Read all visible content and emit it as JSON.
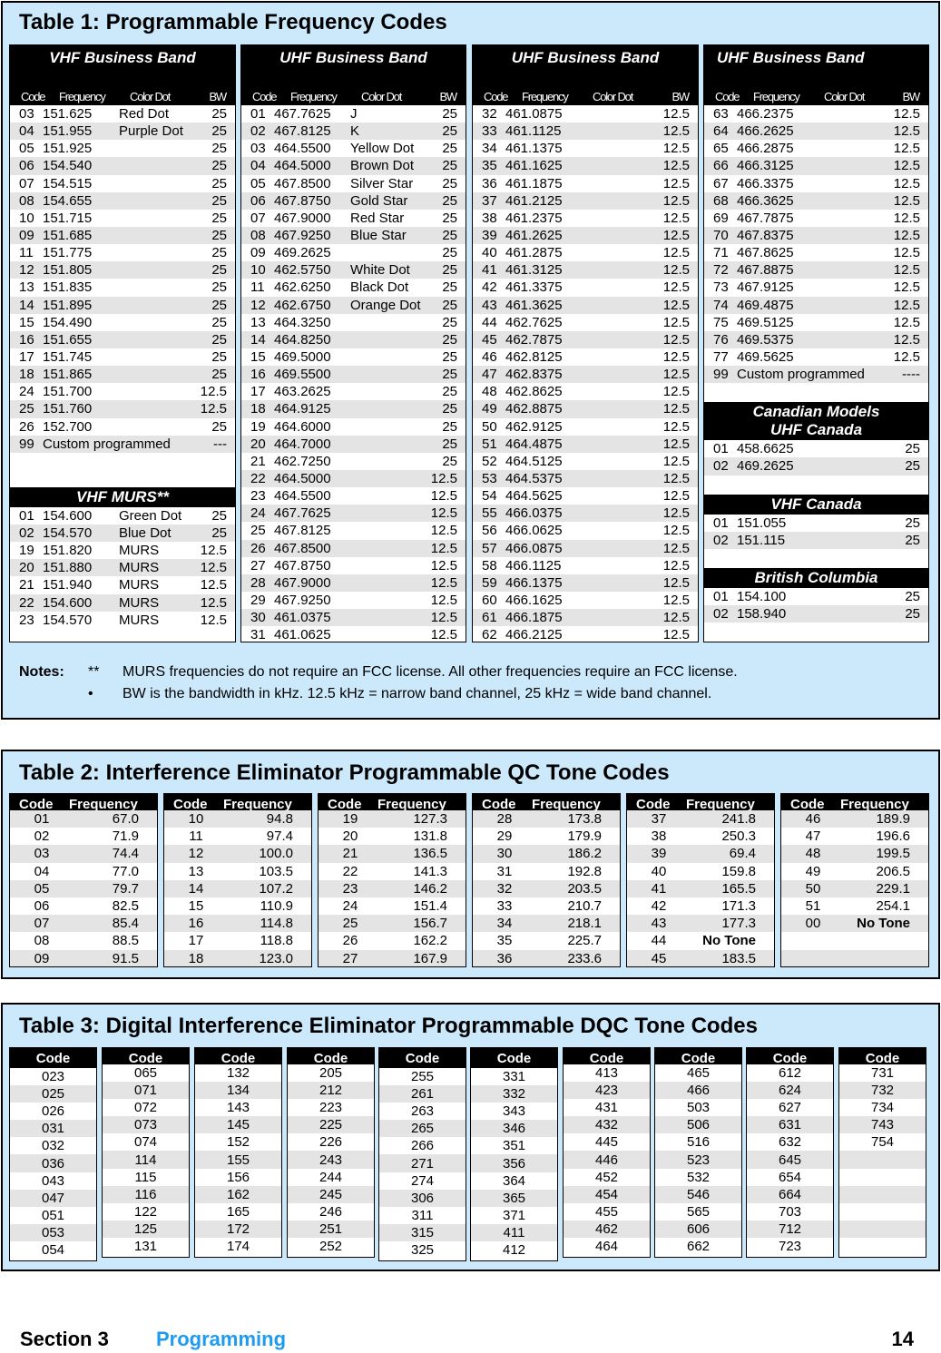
{
  "table1": {
    "title": "Table 1:  Programmable Frequency Codes",
    "col_headers": [
      "Code",
      "Frequency",
      "Color Dot",
      "BW"
    ],
    "vhf_business": {
      "title": "VHF Business Band",
      "rows": [
        [
          "03",
          "151.625",
          "Red Dot",
          "25"
        ],
        [
          "04",
          "151.955",
          "Purple Dot",
          "25"
        ],
        [
          "05",
          "151.925",
          "",
          "25"
        ],
        [
          "06",
          "154.540",
          "",
          "25"
        ],
        [
          "07",
          "154.515",
          "",
          "25"
        ],
        [
          "08",
          "154.655",
          "",
          "25"
        ],
        [
          "10",
          "151.715",
          "",
          "25"
        ],
        [
          "09",
          "151.685",
          "",
          "25"
        ],
        [
          "11",
          "151.775",
          "",
          "25"
        ],
        [
          "12",
          "151.805",
          "",
          "25"
        ],
        [
          "13",
          "151.835",
          "",
          "25"
        ],
        [
          "14",
          "151.895",
          "",
          "25"
        ],
        [
          "15",
          "154.490",
          "",
          "25"
        ],
        [
          "16",
          "151.655",
          "",
          "25"
        ],
        [
          "17",
          "151.745",
          "",
          "25"
        ],
        [
          "18",
          "151.865",
          "",
          "25"
        ],
        [
          "24",
          "151.700",
          "",
          "12.5"
        ],
        [
          "25",
          "151.760",
          "",
          "12.5"
        ],
        [
          "26",
          "152.700",
          "",
          "25"
        ],
        [
          "99",
          "Custom programmed",
          "",
          "---"
        ]
      ]
    },
    "vhf_murs": {
      "title": "VHF MURS**",
      "rows": [
        [
          "01",
          "154.600",
          "Green Dot",
          "25"
        ],
        [
          "02",
          "154.570",
          "Blue Dot",
          "25"
        ],
        [
          "19",
          "151.820",
          "MURS",
          "12.5"
        ],
        [
          "20",
          "151.880",
          "MURS",
          "12.5"
        ],
        [
          "21",
          "151.940",
          "MURS",
          "12.5"
        ],
        [
          "22",
          "154.600",
          "MURS",
          "12.5"
        ],
        [
          "23",
          "154.570",
          "MURS",
          "12.5"
        ]
      ]
    },
    "uhf_business_1": {
      "title": "UHF Business Band",
      "rows": [
        [
          "01",
          "467.7625",
          "J",
          "25"
        ],
        [
          "02",
          "467.8125",
          "K",
          "25"
        ],
        [
          "03",
          "464.5500",
          "Yellow Dot",
          "25"
        ],
        [
          "04",
          "464.5000",
          "Brown Dot",
          "25"
        ],
        [
          "05",
          "467.8500",
          "Silver Star",
          "25"
        ],
        [
          "06",
          "467.8750",
          "Gold Star",
          "25"
        ],
        [
          "07",
          "467.9000",
          "Red Star",
          "25"
        ],
        [
          "08",
          "467.9250",
          "Blue Star",
          "25"
        ],
        [
          "09",
          "469.2625",
          "",
          "25"
        ],
        [
          "10",
          "462.5750",
          "White Dot",
          "25"
        ],
        [
          "11",
          "462.6250",
          "Black Dot",
          "25"
        ],
        [
          "12",
          "462.6750",
          "Orange Dot",
          "25"
        ],
        [
          "13",
          "464.3250",
          "",
          "25"
        ],
        [
          "14",
          "464.8250",
          "",
          "25"
        ],
        [
          "15",
          "469.5000",
          "",
          "25"
        ],
        [
          "16",
          "469.5500",
          "",
          "25"
        ],
        [
          "17",
          "463.2625",
          "",
          "25"
        ],
        [
          "18",
          "464.9125",
          "",
          "25"
        ],
        [
          "19",
          "464.6000",
          "",
          "25"
        ],
        [
          "20",
          "464.7000",
          "",
          "25"
        ],
        [
          "21",
          "462.7250",
          "",
          "25"
        ],
        [
          "22",
          "464.5000",
          "",
          "12.5"
        ],
        [
          "23",
          "464.5500",
          "",
          "12.5"
        ],
        [
          "24",
          "467.7625",
          "",
          "12.5"
        ],
        [
          "25",
          "467.8125",
          "",
          "12.5"
        ],
        [
          "26",
          "467.8500",
          "",
          "12.5"
        ],
        [
          "27",
          "467.8750",
          "",
          "12.5"
        ],
        [
          "28",
          "467.9000",
          "",
          "12.5"
        ],
        [
          "29",
          "467.9250",
          "",
          "12.5"
        ],
        [
          "30",
          "461.0375",
          "",
          "12.5"
        ],
        [
          "31",
          "461.0625",
          "",
          "12.5"
        ]
      ]
    },
    "uhf_business_2": {
      "title": "UHF Business Band",
      "rows": [
        [
          "32",
          "461.0875",
          "",
          "12.5"
        ],
        [
          "33",
          "461.1125",
          "",
          "12.5"
        ],
        [
          "34",
          "461.1375",
          "",
          "12.5"
        ],
        [
          "35",
          "461.1625",
          "",
          "12.5"
        ],
        [
          "36",
          "461.1875",
          "",
          "12.5"
        ],
        [
          "37",
          "461.2125",
          "",
          "12.5"
        ],
        [
          "38",
          "461.2375",
          "",
          "12.5"
        ],
        [
          "39",
          "461.2625",
          "",
          "12.5"
        ],
        [
          "40",
          "461.2875",
          "",
          "12.5"
        ],
        [
          "41",
          "461.3125",
          "",
          "12.5"
        ],
        [
          "42",
          "461.3375",
          "",
          "12.5"
        ],
        [
          "43",
          "461.3625",
          "",
          "12.5"
        ],
        [
          "44",
          "462.7625",
          "",
          "12.5"
        ],
        [
          "45",
          "462.7875",
          "",
          "12.5"
        ],
        [
          "46",
          "462.8125",
          "",
          "12.5"
        ],
        [
          "47",
          "462.8375",
          "",
          "12.5"
        ],
        [
          "48",
          "462.8625",
          "",
          "12.5"
        ],
        [
          "49",
          "462.8875",
          "",
          "12.5"
        ],
        [
          "50",
          "462.9125",
          "",
          "12.5"
        ],
        [
          "51",
          "464.4875",
          "",
          "12.5"
        ],
        [
          "52",
          "464.5125",
          "",
          "12.5"
        ],
        [
          "53",
          "464.5375",
          "",
          "12.5"
        ],
        [
          "54",
          "464.5625",
          "",
          "12.5"
        ],
        [
          "55",
          "466.0375",
          "",
          "12.5"
        ],
        [
          "56",
          "466.0625",
          "",
          "12.5"
        ],
        [
          "57",
          "466.0875",
          "",
          "12.5"
        ],
        [
          "58",
          "466.1125",
          "",
          "12.5"
        ],
        [
          "59",
          "466.1375",
          "",
          "12.5"
        ],
        [
          "60",
          "466.1625",
          "",
          "12.5"
        ],
        [
          "61",
          "466.1875",
          "",
          "12.5"
        ],
        [
          "62",
          "466.2125",
          "",
          "12.5"
        ]
      ]
    },
    "uhf_business_3": {
      "title": "UHF Business Band",
      "rows": [
        [
          "63",
          "466.2375",
          "",
          "12.5"
        ],
        [
          "64",
          "466.2625",
          "",
          "12.5"
        ],
        [
          "65",
          "466.2875",
          "",
          "12.5"
        ],
        [
          "66",
          "466.3125",
          "",
          "12.5"
        ],
        [
          "67",
          "466.3375",
          "",
          "12.5"
        ],
        [
          "68",
          "466.3625",
          "",
          "12.5"
        ],
        [
          "69",
          "467.7875",
          "",
          "12.5"
        ],
        [
          "70",
          "467.8375",
          "",
          "12.5"
        ],
        [
          "71",
          "467.8625",
          "",
          "12.5"
        ],
        [
          "72",
          "467.8875",
          "",
          "12.5"
        ],
        [
          "73",
          "467.9125",
          "",
          "12.5"
        ],
        [
          "74",
          "469.4875",
          "",
          "12.5"
        ],
        [
          "75",
          "469.5125",
          "",
          "12.5"
        ],
        [
          "76",
          "469.5375",
          "",
          "12.5"
        ],
        [
          "77",
          "469.5625",
          "",
          "12.5"
        ],
        [
          "99",
          "Custom programmed",
          "",
          "----"
        ]
      ]
    },
    "canada_uhf": {
      "title_line1": "Canadian Models",
      "title_line2": "UHF Canada",
      "rows": [
        [
          "01",
          "458.6625",
          "",
          "25"
        ],
        [
          "02",
          "469.2625",
          "",
          "25"
        ]
      ]
    },
    "canada_vhf": {
      "title": "VHF Canada",
      "rows": [
        [
          "01",
          "151.055",
          "",
          "25"
        ],
        [
          "02",
          "151.115",
          "",
          "25"
        ]
      ]
    },
    "british_columbia": {
      "title": "British Columbia",
      "rows": [
        [
          "01",
          "154.100",
          "",
          "25"
        ],
        [
          "02",
          "158.940",
          "",
          "25"
        ]
      ]
    },
    "notes": {
      "label": "Notes:",
      "marker1": "**",
      "text1": "MURS frequencies do not require an FCC license.  All other frequencies require an FCC license.",
      "marker2": "•",
      "text2": "BW is the bandwidth in kHz.  12.5 kHz = narrow band channel, 25 kHz = wide band channel."
    }
  },
  "table2": {
    "title": "Table 2:  Interference Eliminator Programmable QC Tone Codes",
    "col_headers": [
      "Code",
      "Frequency"
    ],
    "columns": [
      [
        [
          "01",
          "67.0"
        ],
        [
          "02",
          "71.9"
        ],
        [
          "03",
          "74.4"
        ],
        [
          "04",
          "77.0"
        ],
        [
          "05",
          "79.7"
        ],
        [
          "06",
          "82.5"
        ],
        [
          "07",
          "85.4"
        ],
        [
          "08",
          "88.5"
        ],
        [
          "09",
          "91.5"
        ]
      ],
      [
        [
          "10",
          "94.8"
        ],
        [
          "11",
          "97.4"
        ],
        [
          "12",
          "100.0"
        ],
        [
          "13",
          "103.5"
        ],
        [
          "14",
          "107.2"
        ],
        [
          "15",
          "110.9"
        ],
        [
          "16",
          "114.8"
        ],
        [
          "17",
          "118.8"
        ],
        [
          "18",
          "123.0"
        ]
      ],
      [
        [
          "19",
          "127.3"
        ],
        [
          "20",
          "131.8"
        ],
        [
          "21",
          "136.5"
        ],
        [
          "22",
          "141.3"
        ],
        [
          "23",
          "146.2"
        ],
        [
          "24",
          "151.4"
        ],
        [
          "25",
          "156.7"
        ],
        [
          "26",
          "162.2"
        ],
        [
          "27",
          "167.9"
        ]
      ],
      [
        [
          "28",
          "173.8"
        ],
        [
          "29",
          "179.9"
        ],
        [
          "30",
          "186.2"
        ],
        [
          "31",
          "192.8"
        ],
        [
          "32",
          "203.5"
        ],
        [
          "33",
          "210.7"
        ],
        [
          "34",
          "218.1"
        ],
        [
          "35",
          "225.7"
        ],
        [
          "36",
          "233.6"
        ]
      ],
      [
        [
          "37",
          "241.8"
        ],
        [
          "38",
          "250.3"
        ],
        [
          "39",
          "69.4"
        ],
        [
          "40",
          "159.8"
        ],
        [
          "41",
          "165.5"
        ],
        [
          "42",
          "171.3"
        ],
        [
          "43",
          "177.3"
        ],
        [
          "44",
          "No Tone"
        ],
        [
          "45",
          "183.5"
        ]
      ],
      [
        [
          "46",
          "189.9"
        ],
        [
          "47",
          "196.6"
        ],
        [
          "48",
          "199.5"
        ],
        [
          "49",
          "206.5"
        ],
        [
          "50",
          "229.1"
        ],
        [
          "51",
          "254.1"
        ],
        [
          "00",
          "No Tone"
        ],
        [
          "",
          ""
        ],
        [
          "",
          ""
        ]
      ]
    ]
  },
  "table3": {
    "title": "Table 3:   Digital Interference Eliminator Programmable DQC Tone Codes",
    "col_header": "Code",
    "columns": [
      [
        "023",
        "025",
        "026",
        "031",
        "032",
        "036",
        "043",
        "047",
        "051",
        "053",
        "054"
      ],
      [
        "065",
        "071",
        "072",
        "073",
        "074",
        "114",
        "115",
        "116",
        "122",
        "125",
        "131"
      ],
      [
        "132",
        "134",
        "143",
        "145",
        "152",
        "155",
        "156",
        "162",
        "165",
        "172",
        "174"
      ],
      [
        "205",
        "212",
        "223",
        "225",
        "226",
        "243",
        "244",
        "245",
        "246",
        "251",
        "252"
      ],
      [
        "255",
        "261",
        "263",
        "265",
        "266",
        "271",
        "274",
        "306",
        "311",
        "315",
        "325"
      ],
      [
        "331",
        "332",
        "343",
        "346",
        "351",
        "356",
        "364",
        "365",
        "371",
        "411",
        "412"
      ],
      [
        "413",
        "423",
        "431",
        "432",
        "445",
        "446",
        "452",
        "454",
        "455",
        "462",
        "464"
      ],
      [
        "465",
        "466",
        "503",
        "506",
        "516",
        "523",
        "532",
        "546",
        "565",
        "606",
        "662"
      ],
      [
        "612",
        "624",
        "627",
        "631",
        "632",
        "645",
        "654",
        "664",
        "703",
        "712",
        "723"
      ],
      [
        "731",
        "732",
        "734",
        "743",
        "754",
        "",
        "",
        "",
        "",
        "",
        ""
      ]
    ]
  },
  "footer": {
    "section": "Section 3",
    "chapter": "Programming",
    "page": "14"
  },
  "colors": {
    "panel_bg": "#cce9fb",
    "header_bg": "#000000",
    "row_alt": "#e4e4e4",
    "chapter_accent": "#1e9bf0"
  }
}
